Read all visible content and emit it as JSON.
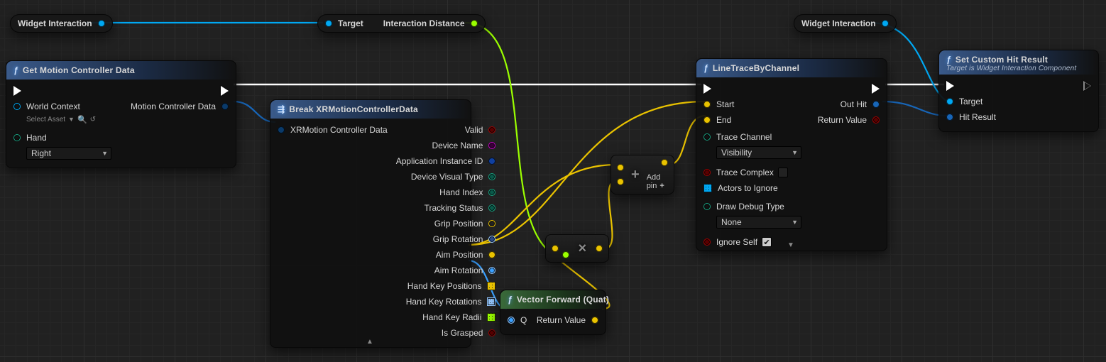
{
  "chips": {
    "wi1_label": "Widget Interaction",
    "target_label": "Target",
    "interaction_distance_label": "Interaction Distance",
    "wi2_label": "Widget Interaction"
  },
  "getmcd": {
    "title": "Get Motion Controller Data",
    "world_context_label": "World Context",
    "select_asset_text": "Select Asset",
    "hand_label": "Hand",
    "hand_value": "Right",
    "out_label": "Motion Controller Data"
  },
  "breakxr": {
    "title": "Break XRMotionControllerData",
    "in_label": "XRMotion Controller Data",
    "outs": {
      "valid": "Valid",
      "device_name": "Device Name",
      "app_id": "Application Instance ID",
      "device_visual": "Device Visual Type",
      "hand_index": "Hand Index",
      "tracking_status": "Tracking Status",
      "grip_pos": "Grip Position",
      "grip_rot": "Grip Rotation",
      "aim_pos": "Aim Position",
      "aim_rot": "Aim Rotation",
      "hand_key_pos": "Hand Key Positions",
      "hand_key_rot": "Hand Key Rotations",
      "hand_key_radii": "Hand Key Radii",
      "is_grasped": "Is Grasped"
    }
  },
  "vecfwd": {
    "title": "Vector Forward (Quat)",
    "q_label": "Q",
    "rv_label": "Return Value"
  },
  "add": {
    "addpin_label": "Add pin"
  },
  "trace": {
    "title": "LineTraceByChannel",
    "start": "Start",
    "end": "End",
    "trace_channel": "Trace Channel",
    "trace_channel_value": "Visibility",
    "trace_complex": "Trace Complex",
    "actors_ignore": "Actors to Ignore",
    "draw_debug": "Draw Debug Type",
    "draw_debug_value": "None",
    "ignore_self": "Ignore Self",
    "ignore_self_checked": true,
    "out_hit": "Out Hit",
    "return_value": "Return Value"
  },
  "sethit": {
    "title": "Set Custom Hit Result",
    "sub": "Target is Widget Interaction Component",
    "target": "Target",
    "hit_result": "Hit Result"
  }
}
